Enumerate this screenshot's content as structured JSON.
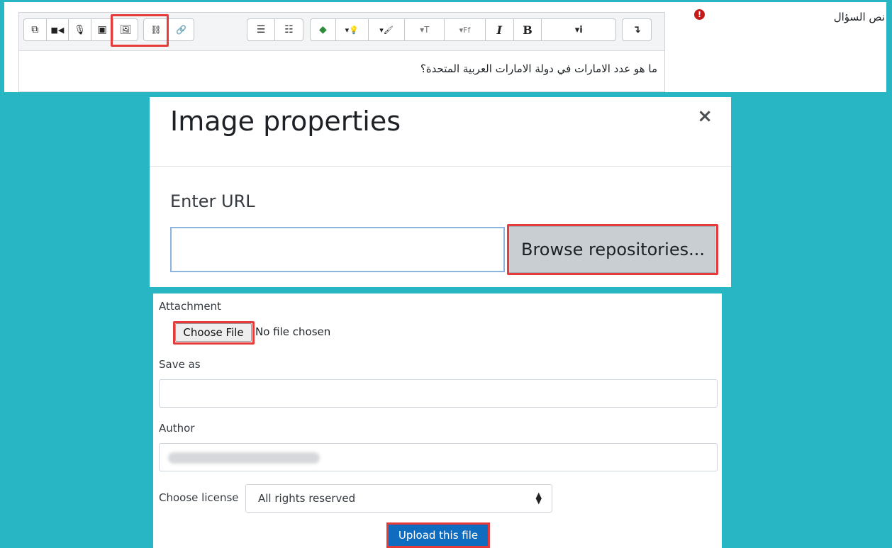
{
  "editor": {
    "question_label": "نص السؤال",
    "required_icon": "!",
    "question_text": "ما هو عدد الامارات في دولة الامارات العربية المتحدة؟",
    "toolbar": [
      {
        "name": "copy-icon",
        "glyph": "⧉"
      },
      {
        "name": "video-icon",
        "glyph": "■◀"
      },
      {
        "name": "microphone-icon",
        "glyph": "🎙"
      },
      {
        "name": "media-icon",
        "glyph": "▣"
      },
      {
        "name": "image-icon",
        "glyph": "🖼"
      },
      {
        "name": "unlink-icon",
        "glyph": "⛓"
      },
      {
        "name": "link-icon",
        "glyph": "🔗"
      },
      {
        "name": "ordered-list-icon",
        "glyph": "☰"
      },
      {
        "name": "unordered-list-icon",
        "glyph": "☷"
      },
      {
        "name": "h5p-icon",
        "glyph": "◆"
      },
      {
        "name": "hint-dropdown-icon",
        "glyph": "▾💡"
      },
      {
        "name": "brush-dropdown-icon",
        "glyph": "▾🖌"
      },
      {
        "name": "font-size-dropdown-icon",
        "glyph": "▾T"
      },
      {
        "name": "font-family-dropdown-icon",
        "glyph": "▾Ff"
      },
      {
        "name": "italic-icon",
        "glyph": "I"
      },
      {
        "name": "bold-icon",
        "glyph": "B"
      },
      {
        "name": "info-dropdown-icon",
        "glyph": "▾i"
      },
      {
        "name": "collapse-toolbar-icon",
        "glyph": "↴"
      }
    ]
  },
  "image_dialog": {
    "title": "Image properties",
    "close_glyph": "×",
    "url_label": "Enter URL",
    "url_value": "",
    "browse_button": "Browse repositories..."
  },
  "upload_form": {
    "attachment_label": "Attachment",
    "choose_file_button": "Choose File",
    "no_file_text": "No file chosen",
    "save_as_label": "Save as",
    "save_as_value": "",
    "author_label": "Author",
    "license_label": "Choose license",
    "license_selected": "All rights reserved",
    "upload_button": "Upload this file"
  },
  "colors": {
    "background": "#29b6c4",
    "highlight": "#e53b3b",
    "primary": "#0f6cbf"
  }
}
